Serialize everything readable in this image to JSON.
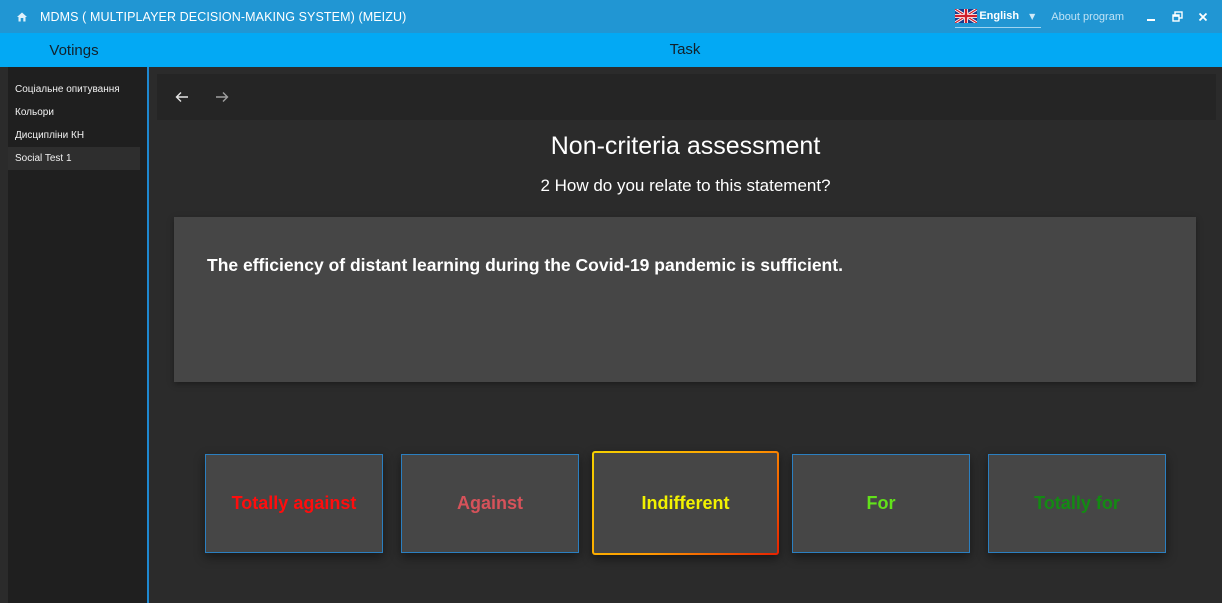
{
  "window": {
    "title": "MDMS ( MULTIPLAYER DECISION-MAKING SYSTEM)  (MEIZU)",
    "language": "English",
    "about_label": "About program"
  },
  "header": {
    "left_label": "Votings",
    "center_label": "Task"
  },
  "sidebar": {
    "items": [
      {
        "label": "Соціальне опитування"
      },
      {
        "label": "Кольори"
      },
      {
        "label": "Дисципліни КН"
      },
      {
        "label": "Social Test 1",
        "selected": true
      }
    ]
  },
  "main": {
    "title": "Non-criteria assessment",
    "question": "2 How do you relate to this statement?",
    "statement": "The efficiency of distant learning during the Covid-19 pandemic is sufficient.",
    "options": [
      {
        "label": "Totally against",
        "color": "#ff0d0d"
      },
      {
        "label": "Against",
        "color": "#d6525a"
      },
      {
        "label": "Indifferent",
        "color": "#f2f200",
        "selected": true
      },
      {
        "label": "For",
        "color": "#62e21a"
      },
      {
        "label": "Totally for",
        "color": "#138a13"
      }
    ]
  },
  "colors": {
    "titlebar": "#2196d3",
    "subbar": "#03a9f4",
    "background": "#2b2b2b",
    "card": "#464646",
    "accent_border": "#2b7fc0"
  }
}
